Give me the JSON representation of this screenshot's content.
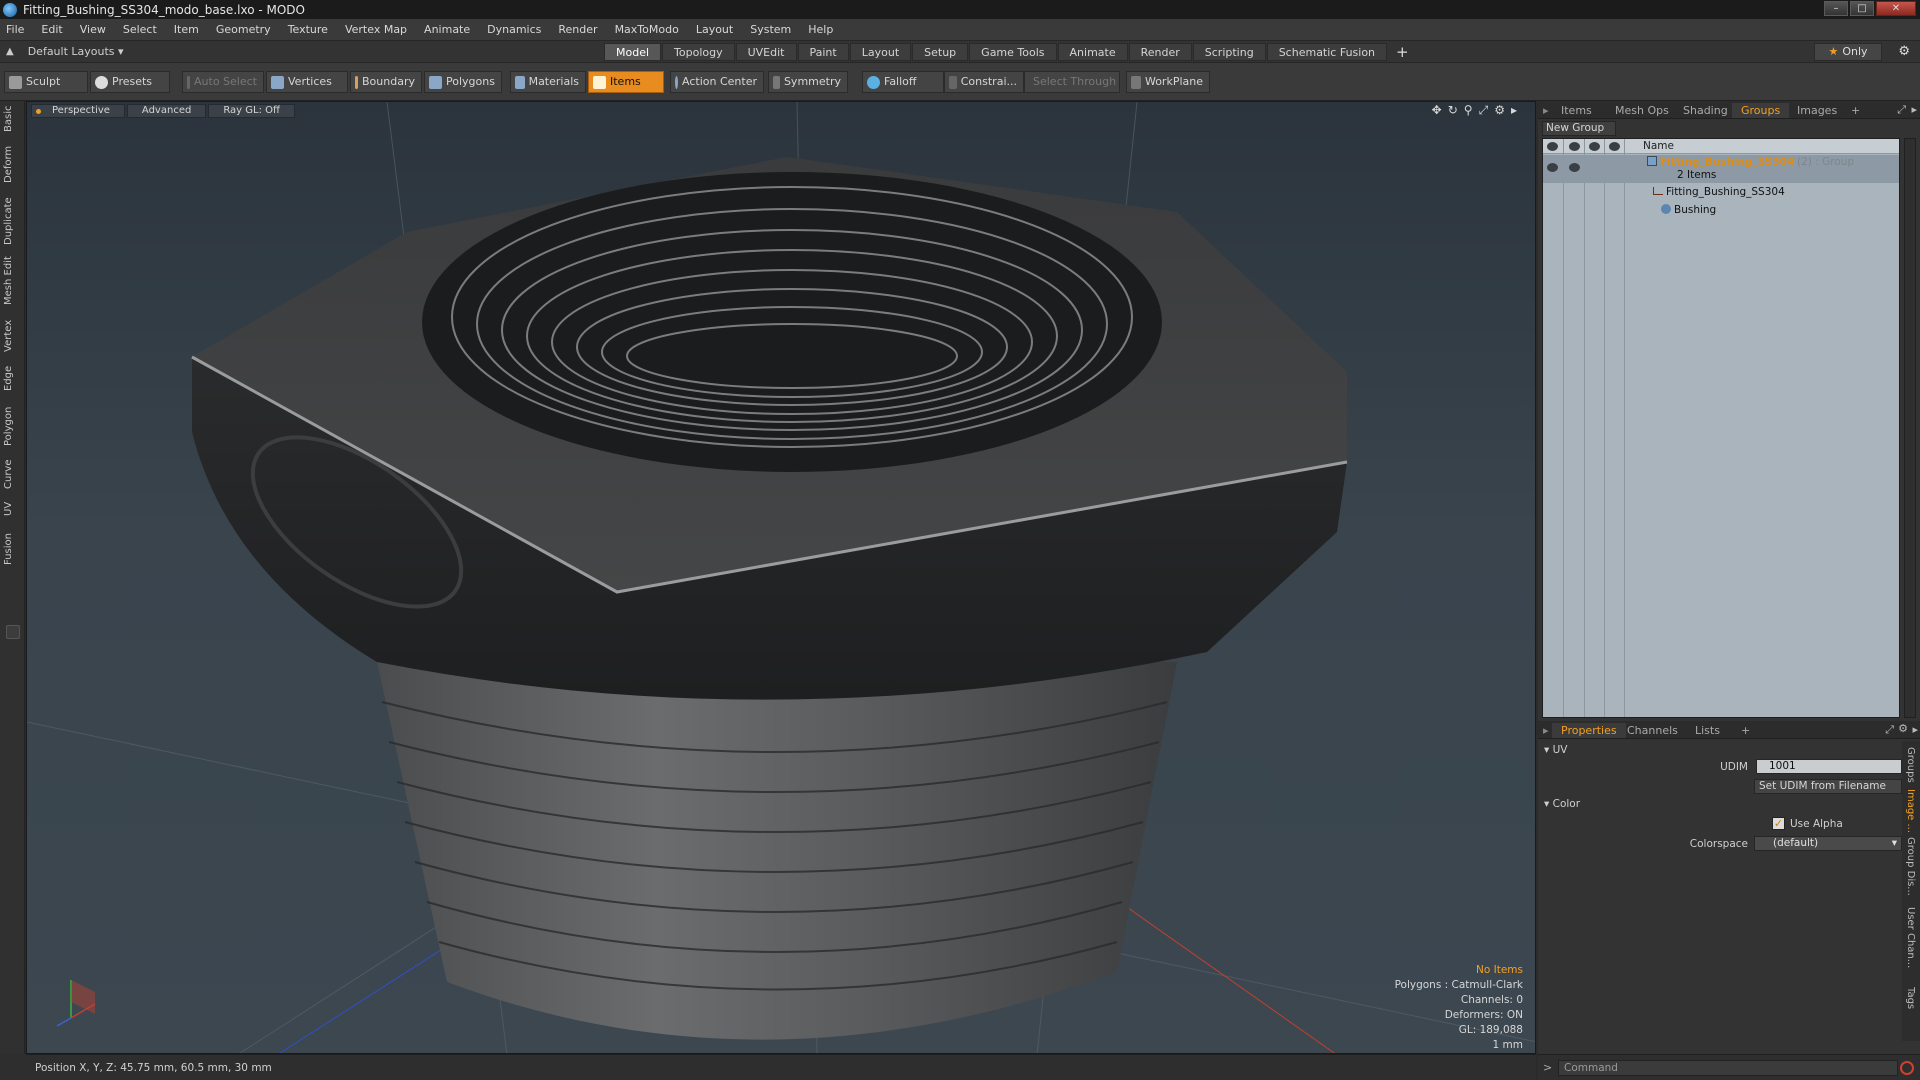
{
  "window": {
    "title": "Fitting_Bushing_SS304_modo_base.lxo - MODO",
    "buttons": [
      "–",
      "□",
      "✕"
    ]
  },
  "menu": [
    "File",
    "Edit",
    "View",
    "Select",
    "Item",
    "Geometry",
    "Texture",
    "Vertex Map",
    "Animate",
    "Dynamics",
    "Render",
    "MaxToModo",
    "Layout",
    "System",
    "Help"
  ],
  "layoutbar": {
    "layouts_label": "Default Layouts ▾",
    "tabs": [
      "Model",
      "Topology",
      "UVEdit",
      "Paint",
      "Layout",
      "Setup",
      "Game Tools",
      "Animate",
      "Render",
      "Scripting",
      "Schematic Fusion"
    ],
    "active_tab": "Model",
    "plus": "+",
    "only_label": "Only"
  },
  "toolbar": {
    "sculpt": "Sculpt",
    "presets": "Presets",
    "auto_select": "Auto Select",
    "vertices": "Vertices",
    "boundary": "Boundary",
    "polygons": "Polygons",
    "materials": "Materials",
    "items": "Items",
    "action_center": "Action Center",
    "symmetry": "Symmetry",
    "falloff": "Falloff",
    "constraints": "Constrai...",
    "select_through": "Select Through",
    "workplane": "WorkPlane"
  },
  "left_tabs": [
    "Basic",
    "Deform",
    "Duplicate",
    "Mesh Edit",
    "Vertex",
    "Edge",
    "Polygon",
    "Curve",
    "UV",
    "Fusion"
  ],
  "viewport": {
    "view_mode": "Perspective",
    "shading": "Advanced",
    "raygl": "Ray GL: Off",
    "info": {
      "no_items": "No Items",
      "polygons": "Polygons : Catmull-Clark",
      "channels": "Channels: 0",
      "deformers": "Deformers: ON",
      "gl": "GL: 189,088",
      "unit": "1 mm"
    }
  },
  "right_panel": {
    "top_tabs": [
      "Items",
      "Mesh Ops",
      "Shading",
      "Groups",
      "Images",
      "+"
    ],
    "active_top_tab": "Groups",
    "new_group": "New Group",
    "column_name": "Name",
    "group": {
      "name": "Fitting_Bushing_SS304",
      "suffix": "(2) : Group",
      "count": "2 Items",
      "children": [
        "Fitting_Bushing_SS304",
        "Bushing"
      ]
    },
    "bottom_tabs": [
      "Properties",
      "Channels",
      "Lists",
      "+"
    ],
    "active_bottom_tab": "Properties",
    "properties": {
      "uv_section": "UV",
      "udim_label": "UDIM",
      "udim_value": "1001",
      "set_udim": "Set UDIM from Filename",
      "color_section": "Color",
      "use_alpha": "Use Alpha",
      "colorspace_label": "Colorspace",
      "colorspace_value": "(default)"
    },
    "side_tabs": [
      "Groups",
      "Image ...",
      "Group Dis...",
      "User Chan...",
      "Tags"
    ]
  },
  "command": {
    "prompt": ">",
    "placeholder": "Command"
  },
  "status": {
    "position": "Position X, Y, Z:  45.75 mm, 60.5 mm, 30 mm"
  }
}
